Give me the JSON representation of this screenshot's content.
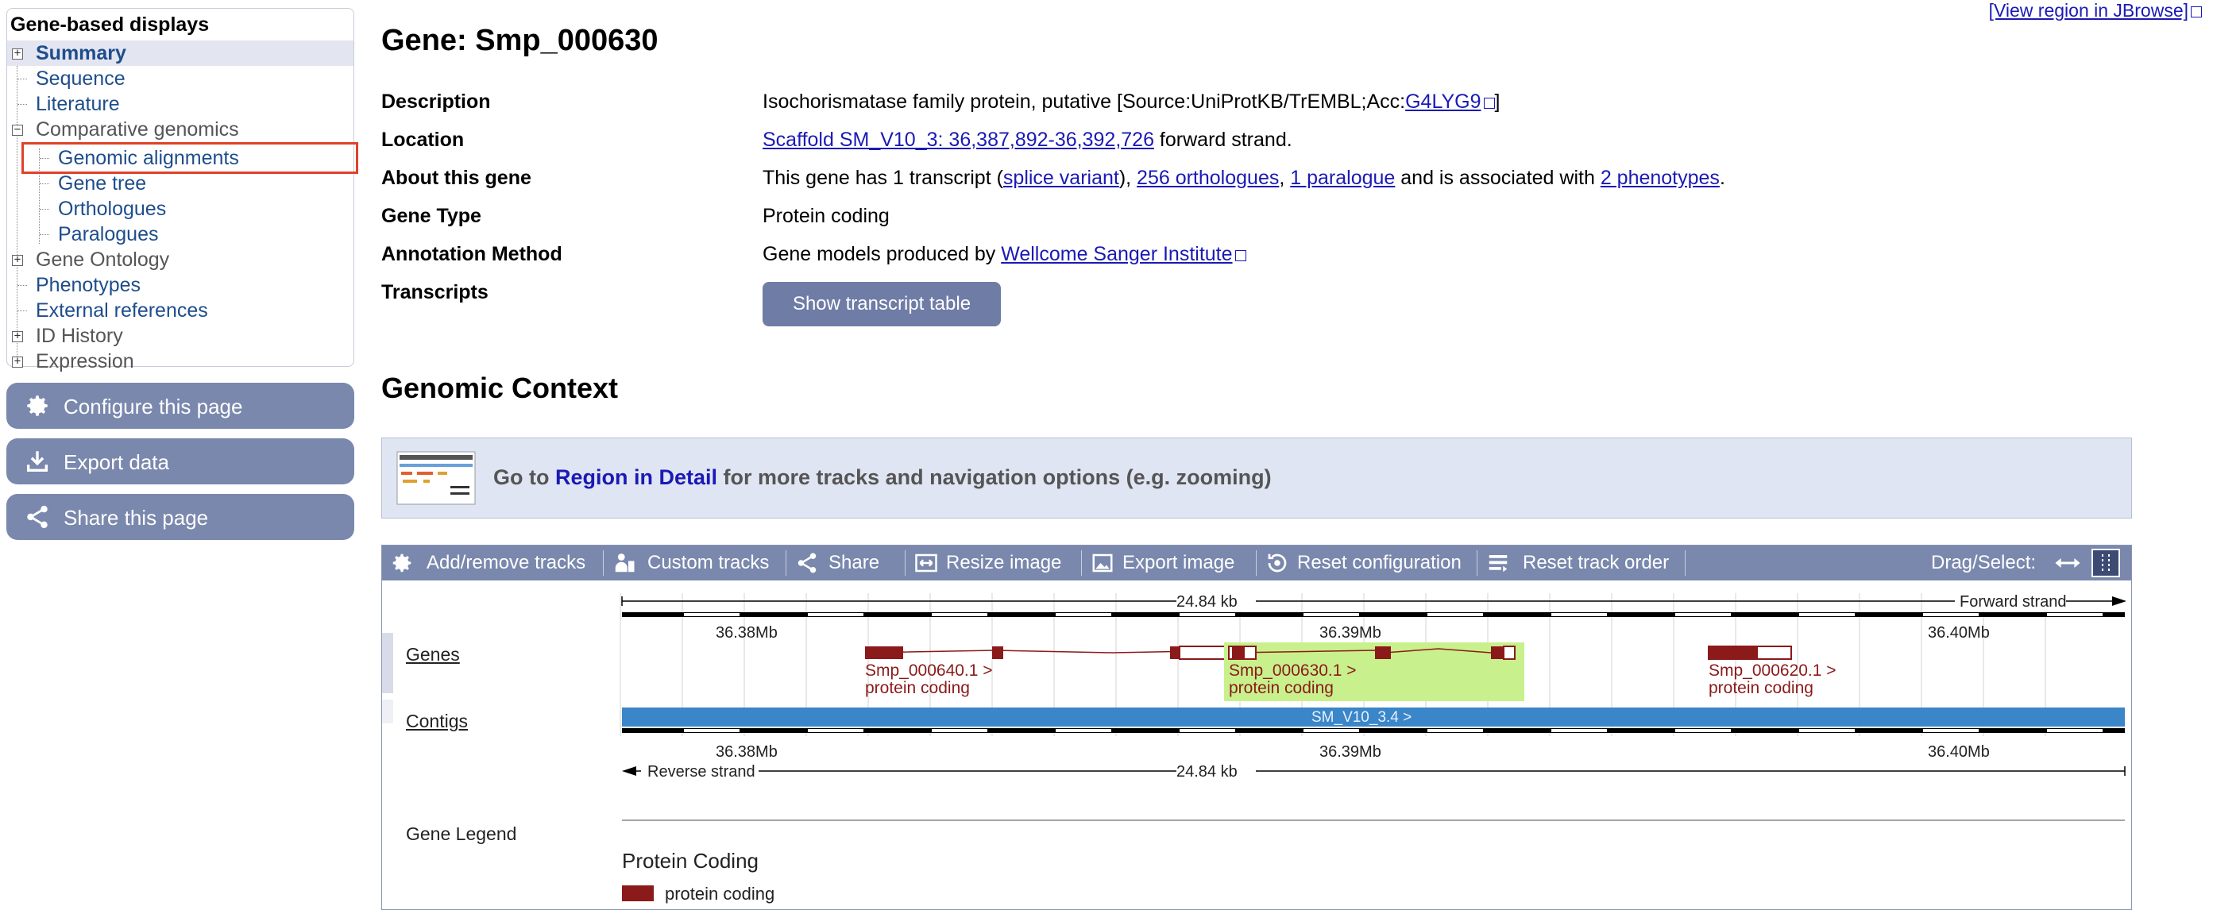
{
  "top_link": "[View region in JBrowse]",
  "sidebar": {
    "title": "Gene-based displays",
    "items": [
      {
        "label": "Summary"
      },
      {
        "label": "Sequence"
      },
      {
        "label": "Literature"
      },
      {
        "label": "Comparative genomics"
      },
      {
        "label": "Genomic alignments"
      },
      {
        "label": "Gene tree"
      },
      {
        "label": "Orthologues"
      },
      {
        "label": "Paralogues"
      },
      {
        "label": "Gene Ontology"
      },
      {
        "label": "Phenotypes"
      },
      {
        "label": "External references"
      },
      {
        "label": "ID History"
      },
      {
        "label": "Expression"
      }
    ],
    "buttons": [
      {
        "label": "Configure this page",
        "icon": "gear-icon"
      },
      {
        "label": "Export data",
        "icon": "download-icon"
      },
      {
        "label": "Share this page",
        "icon": "share-icon"
      }
    ]
  },
  "gene": {
    "title": "Gene: Smp_000630",
    "rows": [
      {
        "label": "Description"
      },
      {
        "label": "Location"
      },
      {
        "label": "About this gene"
      },
      {
        "label": "Gene Type"
      },
      {
        "label": "Annotation Method"
      },
      {
        "label": "Transcripts"
      }
    ],
    "description_text": "Isochorismatase family protein, putative [Source:UniProtKB/TrEMBL;Acc:",
    "description_link": "G4LYG9",
    "description_end": "]",
    "location_link": "Scaffold SM_V10_3: 36,387,892-36,392,726",
    "location_end": " forward strand.",
    "about_1": "This gene has 1 transcript (",
    "about_link1": "splice variant",
    "about_2": "), ",
    "about_link2": "256 orthologues",
    "about_3": ", ",
    "about_link3": "1 paralogue",
    "about_4": " and is associated with ",
    "about_link4": "2 phenotypes",
    "about_5": ".",
    "gene_type": "Protein coding",
    "annotation_text": "Gene models produced by ",
    "annotation_link": "Wellcome Sanger Institute",
    "transcript_button": "Show transcript table"
  },
  "genomic_context": {
    "title": "Genomic Context",
    "goto_1": "Go to ",
    "goto_link": "Region in Detail",
    "goto_2": " for more tracks and navigation options (e.g. zooming)"
  },
  "toolbar": {
    "items": [
      {
        "label": "Add/remove tracks",
        "icon": "gear-icon"
      },
      {
        "label": "Custom tracks",
        "icon": "custom-tracks-icon"
      },
      {
        "label": "Share",
        "icon": "share-icon"
      },
      {
        "label": "Resize image",
        "icon": "resize-icon"
      },
      {
        "label": "Export image",
        "icon": "image-icon"
      },
      {
        "label": "Reset configuration",
        "icon": "reset-icon"
      },
      {
        "label": "Reset track order",
        "icon": "reorder-icon"
      }
    ],
    "drag_select": "Drag/Select:"
  },
  "viewer": {
    "span_top": "24.84 kb",
    "forward_strand": "Forward strand",
    "reverse_strand": "Reverse strand",
    "span_bottom": "24.84 kb",
    "ticks": [
      "36.38Mb",
      "36.39Mb",
      "36.40Mb"
    ],
    "tracks": {
      "genes": "Genes",
      "contigs": "Contigs"
    },
    "genes": [
      {
        "name": "Smp_000640.1 >",
        "biotype": "protein coding"
      },
      {
        "name": "Smp_000630.1 >",
        "biotype": "protein coding"
      },
      {
        "name": "Smp_000620.1 >",
        "biotype": "protein coding"
      }
    ],
    "contig_label": "SM_V10_3.4 >",
    "legend_title": "Gene Legend",
    "legend_heading": "Protein Coding",
    "legend_item": "protein coding",
    "colors": {
      "gene": "#8b1a1a",
      "highlight": "#c8f08c",
      "contig": "#3a86c8",
      "toolbar": "#7a88ad"
    }
  }
}
